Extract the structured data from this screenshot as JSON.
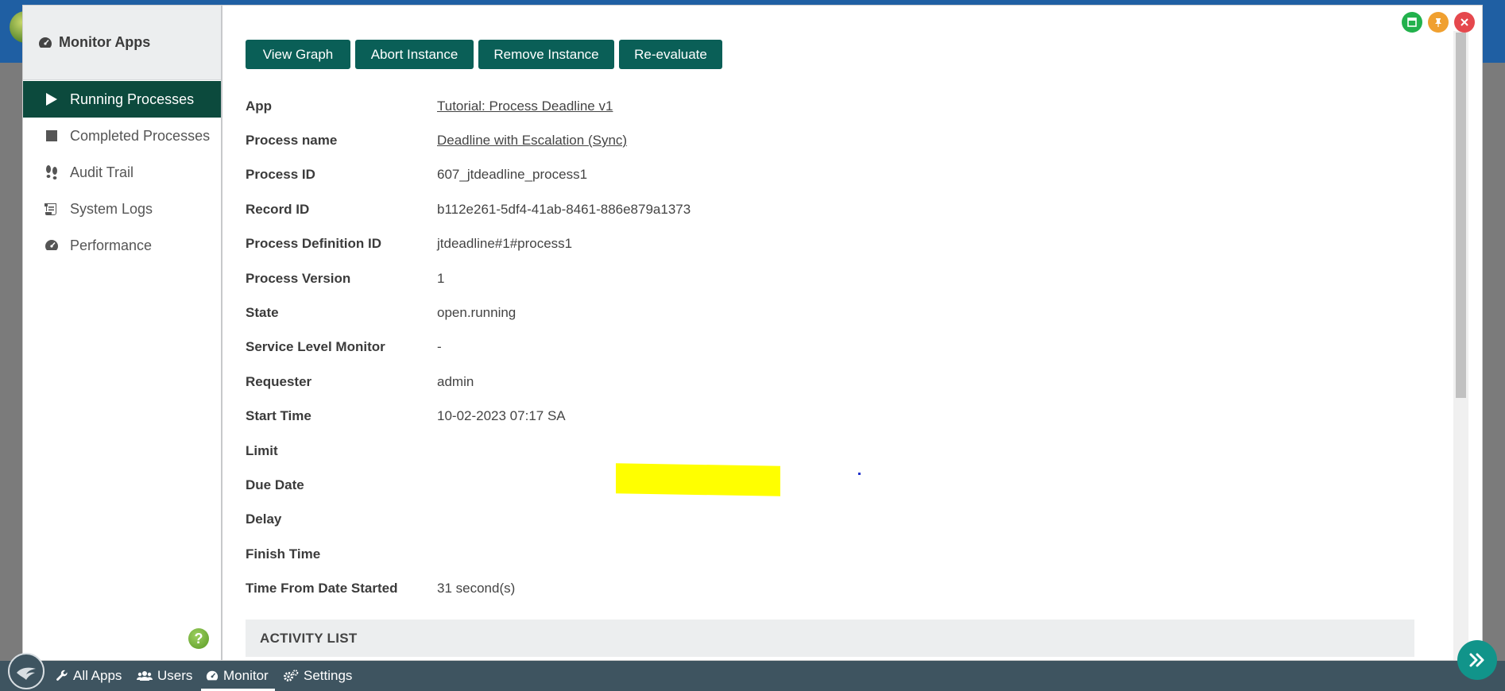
{
  "sidebar": {
    "title": "Monitor Apps",
    "items": [
      {
        "label": "Running Processes",
        "icon": "play-icon",
        "active": true
      },
      {
        "label": "Completed Processes",
        "icon": "stop-icon",
        "active": false
      },
      {
        "label": "Audit Trail",
        "icon": "footprints-icon",
        "active": false
      },
      {
        "label": "System Logs",
        "icon": "scroll-icon",
        "active": false
      },
      {
        "label": "Performance",
        "icon": "tachometer-icon",
        "active": false
      }
    ],
    "help_glyph": "?"
  },
  "toolbar": {
    "view_graph": "View Graph",
    "abort_instance": "Abort Instance",
    "remove_instance": "Remove Instance",
    "re_evaluate": "Re-evaluate"
  },
  "details": [
    {
      "label": "App",
      "value": "Tutorial: Process Deadline v1",
      "link": true
    },
    {
      "label": "Process name",
      "value": "Deadline with Escalation (Sync)",
      "link": true
    },
    {
      "label": "Process ID",
      "value": "607_jtdeadline_process1"
    },
    {
      "label": "Record ID",
      "value": "b112e261-5df4-41ab-8461-886e879a1373"
    },
    {
      "label": "Process Definition ID",
      "value": "jtdeadline#1#process1"
    },
    {
      "label": "Process Version",
      "value": "1"
    },
    {
      "label": "State",
      "value": "open.running"
    },
    {
      "label": "Service Level Monitor",
      "value": "-"
    },
    {
      "label": "Requester",
      "value": "admin"
    },
    {
      "label": "Start Time",
      "value": "10-02-2023 07:17 SA"
    },
    {
      "label": "Limit",
      "value": ""
    },
    {
      "label": "Due Date",
      "value": ""
    },
    {
      "label": "Delay",
      "value": ""
    },
    {
      "label": "Finish Time",
      "value": ""
    },
    {
      "label": "Time From Date Started",
      "value": "31 second(s)"
    }
  ],
  "activity_list": {
    "title": "ACTIVITY LIST"
  },
  "annotation": {
    "highlight_color": "#ffff00"
  },
  "window_controls": {
    "minimize_color": "#22b14c",
    "pin_color": "#f0a030",
    "close_color": "#e5484d"
  },
  "taskbar": {
    "items": [
      {
        "label": "All Apps",
        "icon": "wrench-icon"
      },
      {
        "label": "Users",
        "icon": "users-icon"
      },
      {
        "label": "Monitor",
        "icon": "tachometer-icon",
        "active": true
      },
      {
        "label": "Settings",
        "icon": "cogs-icon"
      }
    ]
  },
  "colors": {
    "accent": "#0a5f57",
    "sidebar_active": "#0c4a3d",
    "taskbar": "#3e5460"
  }
}
